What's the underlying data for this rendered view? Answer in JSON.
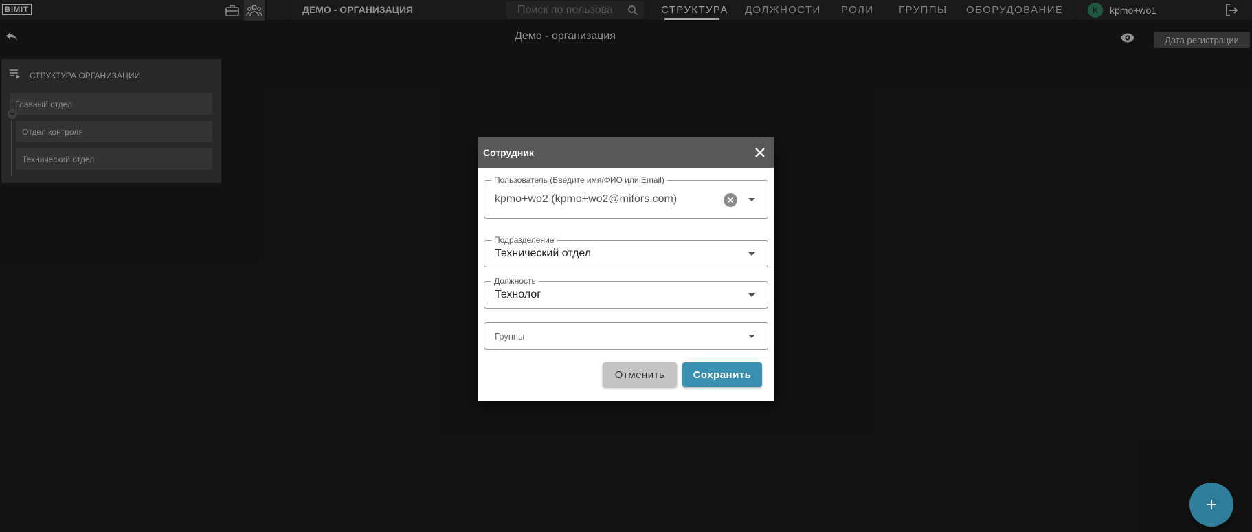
{
  "app": {
    "logo": "BIMIT"
  },
  "topbar": {
    "icons": [
      "briefcase-icon",
      "team-icon"
    ],
    "org_name": "Демо - организация",
    "search": {
      "placeholder": "Поиск по пользова"
    },
    "tabs": [
      {
        "label": "Структура",
        "active": true
      },
      {
        "label": "Должности",
        "active": false
      },
      {
        "label": "Роли",
        "active": false
      },
      {
        "label": "Группы",
        "active": false
      },
      {
        "label": "Оборудование",
        "active": false
      }
    ],
    "user": {
      "initial": "K",
      "name": "kpmo+wo1"
    }
  },
  "page": {
    "title": "Демо - организация",
    "date_button": "Дата регистрации"
  },
  "structure": {
    "title": "Структура организации",
    "root": "Главный отдел",
    "children": [
      "Отдел контроля",
      "Технический отдел"
    ]
  },
  "dialog": {
    "title": "Сотрудник",
    "user_field": {
      "label": "Пользователь (Введите имя/ФИО или Email)",
      "value": "kpmo+wo2 (kpmo+wo2@mifors.com)"
    },
    "department_field": {
      "label": "Подразделение",
      "value": "Технический отдел"
    },
    "position_field": {
      "label": "Должность",
      "value": "Технолог"
    },
    "groups_field": {
      "placeholder": "Группы"
    },
    "cancel": "Отменить",
    "save": "Сохранить"
  },
  "colors": {
    "background": "#1b1b1b",
    "accent": "#3a90b1",
    "fab": "#2f7f9c",
    "avatar": "#2e7d5b"
  }
}
